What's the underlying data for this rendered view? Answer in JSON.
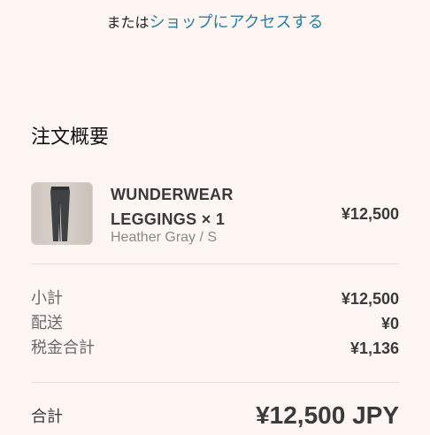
{
  "header": {
    "prefix": "または",
    "shop_link": "ショップにアクセスする"
  },
  "order_summary": {
    "title": "注文概要",
    "item": {
      "name_line1": "WUNDERWEAR",
      "name_line2": "LEGGINGS × 1",
      "variant": "Heather Gray / S",
      "price": "¥12,500",
      "thumbnail_icon": "leggings-image"
    },
    "subtotal": {
      "label": "小計",
      "value": "¥12,500"
    },
    "shipping": {
      "label": "配送",
      "value": "¥0"
    },
    "tax": {
      "label": "税金合計",
      "value": "¥1,136"
    },
    "total": {
      "label": "合計",
      "value": "¥12,500 JPY"
    }
  },
  "colors": {
    "background": "#fdf6f2",
    "link": "#2a7ea5",
    "text": "#3a3a3a",
    "muted": "#8a8a8a"
  }
}
